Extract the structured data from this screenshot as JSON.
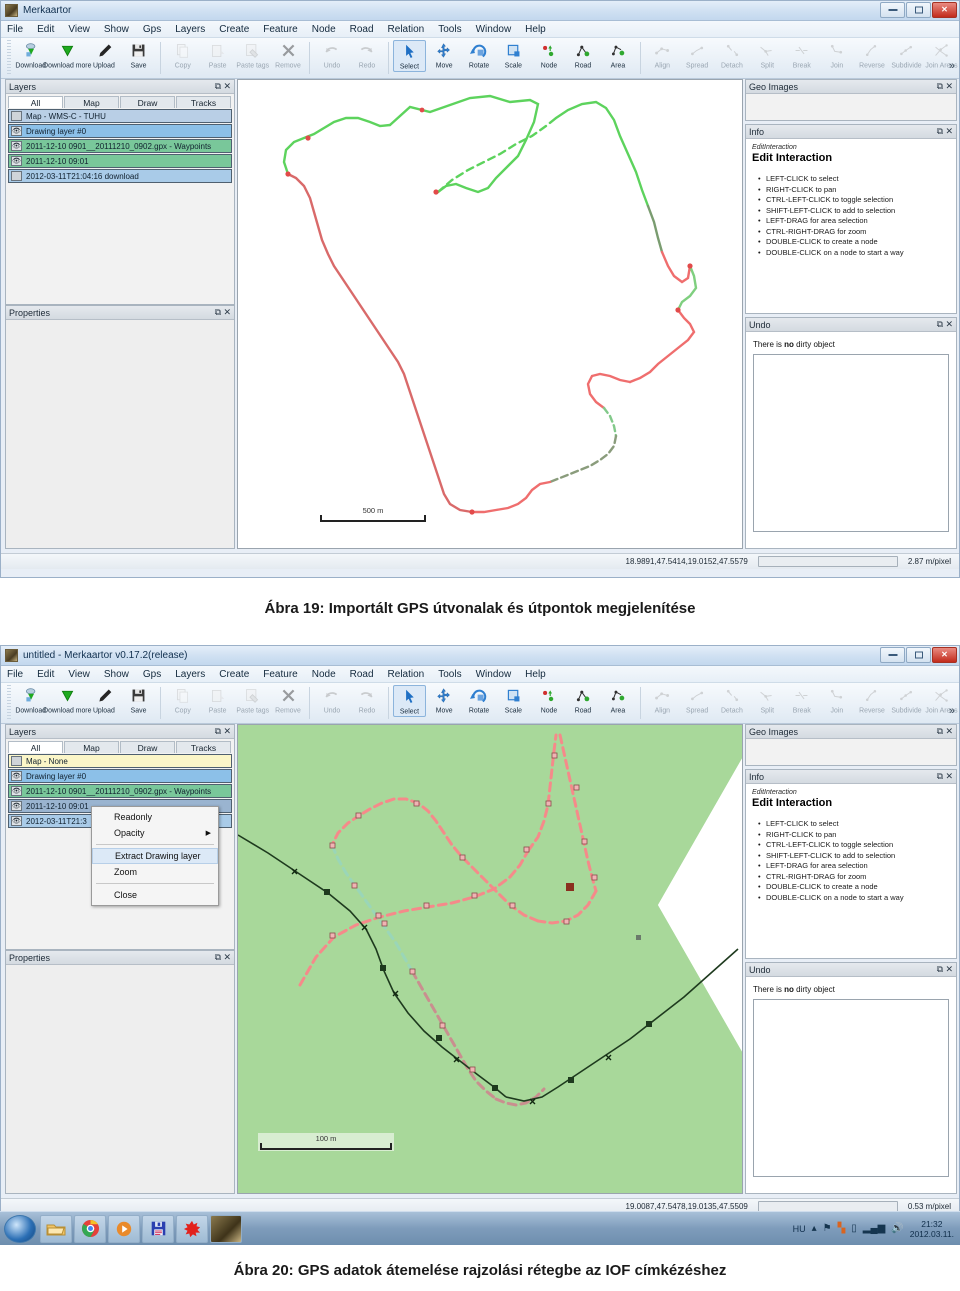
{
  "window1": {
    "title": "Merkaartor",
    "title_icon": "app-icon",
    "menu": [
      "File",
      "Edit",
      "View",
      "Show",
      "Gps",
      "Layers",
      "Create",
      "Feature",
      "Node",
      "Road",
      "Relation",
      "Tools",
      "Window",
      "Help"
    ],
    "toolbar": [
      {
        "label": "Download",
        "icon": "download-icon",
        "enabled": true
      },
      {
        "label": "Download more",
        "icon": "download-more-icon",
        "enabled": true
      },
      {
        "label": "Upload",
        "icon": "upload-icon",
        "enabled": true
      },
      {
        "label": "Save",
        "icon": "save-icon",
        "enabled": true
      },
      {
        "label": "Copy",
        "icon": "copy-icon",
        "enabled": false
      },
      {
        "label": "Paste",
        "icon": "paste-icon",
        "enabled": false
      },
      {
        "label": "Paste tags",
        "icon": "paste-tags-icon",
        "enabled": false
      },
      {
        "label": "Remove",
        "icon": "remove-icon",
        "enabled": false
      },
      {
        "label": "Undo",
        "icon": "undo-icon",
        "enabled": false
      },
      {
        "label": "Redo",
        "icon": "redo-icon",
        "enabled": false
      },
      {
        "label": "Select",
        "icon": "select-arrow-icon",
        "enabled": true,
        "selected": true
      },
      {
        "label": "Move",
        "icon": "move-icon",
        "enabled": true
      },
      {
        "label": "Rotate",
        "icon": "rotate-icon",
        "enabled": true
      },
      {
        "label": "Scale",
        "icon": "scale-icon",
        "enabled": true
      },
      {
        "label": "Node",
        "icon": "node-icon",
        "enabled": true
      },
      {
        "label": "Road",
        "icon": "road-icon",
        "enabled": true
      },
      {
        "label": "Area",
        "icon": "area-icon",
        "enabled": true
      },
      {
        "label": "Align",
        "icon": "align-icon",
        "enabled": false
      },
      {
        "label": "Spread",
        "icon": "spread-icon",
        "enabled": false
      },
      {
        "label": "Detach",
        "icon": "detach-icon",
        "enabled": false
      },
      {
        "label": "Split",
        "icon": "split-icon",
        "enabled": false
      },
      {
        "label": "Break",
        "icon": "break-icon",
        "enabled": false
      },
      {
        "label": "Join",
        "icon": "join-icon",
        "enabled": false
      },
      {
        "label": "Reverse",
        "icon": "reverse-icon",
        "enabled": false
      },
      {
        "label": "Subdivide",
        "icon": "subdivide-icon",
        "enabled": false
      },
      {
        "label": "Join Areas",
        "icon": "join-areas-icon",
        "enabled": false
      }
    ],
    "toolbar_overflow": "»",
    "layers_panel": {
      "title": "Layers",
      "tabs": [
        "All",
        "Map",
        "Draw",
        "Tracks"
      ],
      "active_tab": "All",
      "rows": [
        {
          "name": "Map - WMS-C - TUHU",
          "visible": false,
          "color": "#b9cfe6"
        },
        {
          "name": "Drawing layer #0",
          "visible": true,
          "color": "#8cc0e8"
        },
        {
          "name": "2011-12-10 0901__20111210_0902.gpx - Waypoints",
          "visible": true,
          "color": "#79c79a"
        },
        {
          "name": "2011-12-10 09:01",
          "visible": true,
          "color": "#79c79a"
        },
        {
          "name": "2012-03-11T21:04:16 download",
          "visible": false,
          "color": "#a9cbe8"
        }
      ]
    },
    "properties_panel": {
      "title": "Properties"
    },
    "geo_images_panel": {
      "title": "Geo Images"
    },
    "info_panel": {
      "title": "Info",
      "kicker": "EditInteraction",
      "heading": "Edit Interaction",
      "items": [
        "LEFT-CLICK to select",
        "RIGHT-CLICK to pan",
        "CTRL-LEFT-CLICK to toggle selection",
        "SHIFT-LEFT-CLICK to add to selection",
        "LEFT-DRAG for area selection",
        "CTRL-RIGHT-DRAG for zoom",
        "DOUBLE-CLICK to create a node",
        "DOUBLE-CLICK on a node to start a way"
      ]
    },
    "undo_panel": {
      "title": "Undo",
      "message_pre": "There is ",
      "message_bold": "no",
      "message_post": " dirty object"
    },
    "map": {
      "scale_label": "500 m"
    },
    "statusbar": {
      "coordinates": "18.9891,47.5414,19.0152,47.5579",
      "resolution": "2.87 m/pixel"
    }
  },
  "caption1": "Ábra 19: Importált GPS útvonalak és útpontok megjelenítése",
  "window2": {
    "title": "untitled - Merkaartor v0.17.2(release)",
    "title_icon": "app-icon",
    "menu": [
      "File",
      "Edit",
      "View",
      "Show",
      "Gps",
      "Layers",
      "Create",
      "Feature",
      "Node",
      "Road",
      "Relation",
      "Tools",
      "Window",
      "Help"
    ],
    "layers_panel": {
      "title": "Layers",
      "tabs": [
        "All",
        "Map",
        "Draw",
        "Tracks"
      ],
      "active_tab": "All",
      "rows": [
        {
          "name": "Map - None",
          "visible": false,
          "color": "#fbf6c8"
        },
        {
          "name": "Drawing layer #0",
          "visible": true,
          "color": "#8cc0e8"
        },
        {
          "name": "2011-12-10 0901__20111210_0902.gpx - Waypoints",
          "visible": true,
          "color": "#79c79a"
        },
        {
          "name": "2011-12-10 09:01",
          "visible": true,
          "color": "#9ab4d0"
        },
        {
          "name": "2012-03-11T21:3",
          "visible": true,
          "color": "#a9cbe8"
        }
      ]
    },
    "context_menu": {
      "items": [
        {
          "label": "Readonly",
          "highlighted": false,
          "submenu": false
        },
        {
          "label": "Opacity",
          "highlighted": false,
          "submenu": true
        },
        {
          "label": "Extract Drawing layer",
          "highlighted": true,
          "submenu": false
        },
        {
          "label": "Zoom",
          "highlighted": false,
          "submenu": false
        },
        {
          "label": "Close",
          "highlighted": false,
          "submenu": false
        }
      ]
    },
    "properties_panel": {
      "title": "Properties"
    },
    "geo_images_panel": {
      "title": "Geo Images"
    },
    "info_panel": {
      "title": "Info",
      "kicker": "EditInteraction",
      "heading": "Edit Interaction",
      "items": [
        "LEFT-CLICK to select",
        "RIGHT-CLICK to pan",
        "CTRL-LEFT-CLICK to toggle selection",
        "SHIFT-LEFT-CLICK to add to selection",
        "LEFT-DRAG for area selection",
        "CTRL-RIGHT-DRAG for zoom",
        "DOUBLE-CLICK to create a node",
        "DOUBLE-CLICK on a node to start a way"
      ]
    },
    "undo_panel": {
      "title": "Undo",
      "message_pre": "There is ",
      "message_bold": "no",
      "message_post": " dirty object"
    },
    "map": {
      "scale_label": "100 m"
    },
    "statusbar": {
      "coordinates": "19.0087,47.5478,19.0135,47.5509",
      "resolution": "0.53 m/pixel"
    }
  },
  "taskbar": {
    "start_icon": "windows-start-icon",
    "items": [
      {
        "icon": "explorer-folder-icon",
        "name": "explorer"
      },
      {
        "icon": "chrome-icon",
        "name": "chrome"
      },
      {
        "icon": "media-player-icon",
        "name": "media-player"
      },
      {
        "icon": "floppy-save-icon",
        "name": "save-app"
      },
      {
        "icon": "red-splat-icon",
        "name": "merkaartor"
      },
      {
        "icon": "photo-icon",
        "name": "photo-app"
      }
    ],
    "tray": {
      "language": "HU",
      "icons": [
        "chevron-up-icon",
        "flag-icon",
        "windows-update-icon",
        "battery-icon",
        "signal-icon",
        "volume-icon"
      ],
      "time": "21:32",
      "date": "2012.03.11."
    }
  },
  "caption2": "Ábra 20: GPS adatok átemelése rajzolási rétegbe az IOF címkézéshez"
}
